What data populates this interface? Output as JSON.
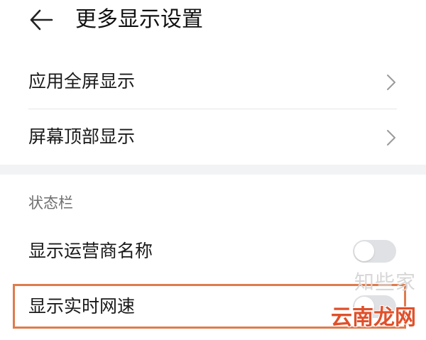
{
  "header": {
    "title": "更多显示设置",
    "back_icon": "arrow-left-icon"
  },
  "rows": [
    {
      "label": "应用全屏显示",
      "control": "chevron-right-icon"
    },
    {
      "label": "屏幕顶部显示",
      "control": "chevron-right-icon"
    }
  ],
  "status_bar_section": {
    "title": "状态栏",
    "items": [
      {
        "label": "显示运营商名称",
        "toggle_on": false
      },
      {
        "label": "显示实时网速",
        "toggle_on": false
      }
    ]
  },
  "watermark": {
    "top": "知些家",
    "bottom": "云南龙网"
  },
  "colors": {
    "highlight_border": "#e07b4c",
    "toggle_off": "#dfe1e4",
    "section_gap": "#f1f3f5",
    "watermark_red": "#e0502a"
  }
}
